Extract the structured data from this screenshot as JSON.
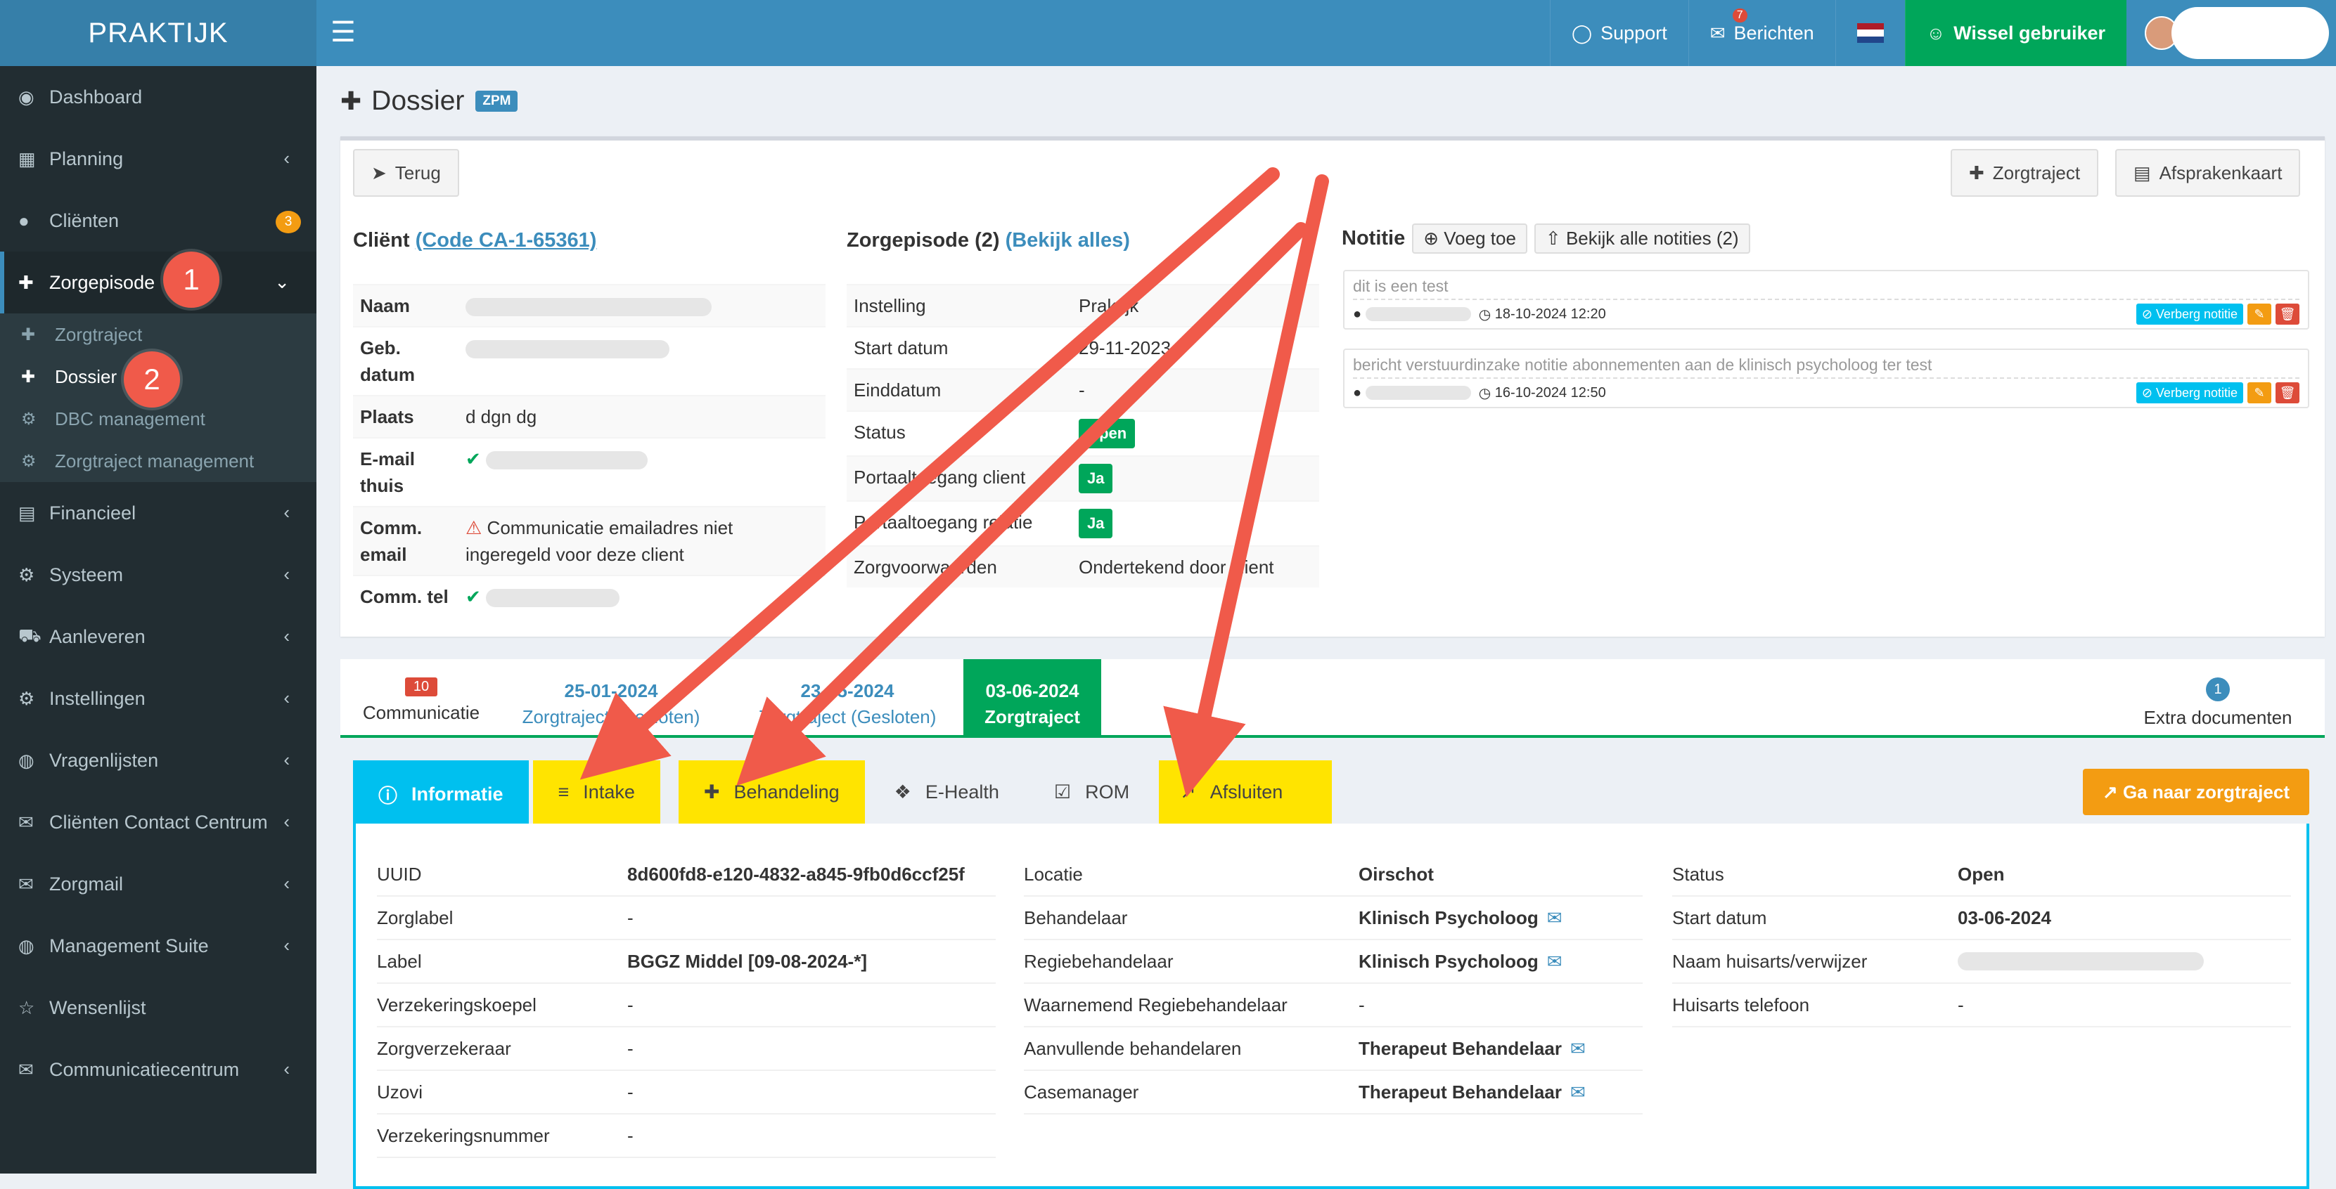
{
  "header": {
    "logo": "PRAKTIJK",
    "support": "Support",
    "berichten": "Berichten",
    "berichten_count": "7",
    "wissel": "Wissel gebruiker"
  },
  "sidebar": {
    "items": [
      {
        "label": "Dashboard",
        "icon": "dashboard-icon"
      },
      {
        "label": "Planning",
        "icon": "calendar-icon"
      },
      {
        "label": "Cliënten",
        "icon": "user-icon",
        "badge": "3"
      },
      {
        "label": "Zorgepisode",
        "icon": "medkit-icon"
      },
      {
        "label": "Financieel",
        "icon": "book-icon"
      },
      {
        "label": "Systeem",
        "icon": "cogs-icon"
      },
      {
        "label": "Aanleveren",
        "icon": "truck-icon"
      },
      {
        "label": "Instellingen",
        "icon": "gear-icon"
      },
      {
        "label": "Vragenlijsten",
        "icon": "globe-icon"
      },
      {
        "label": "Cliënten Contact Centrum",
        "icon": "envelope-icon"
      },
      {
        "label": "Zorgmail",
        "icon": "envelope-icon"
      },
      {
        "label": "Management Suite",
        "icon": "globe-icon"
      },
      {
        "label": "Wensenlijst",
        "icon": "star-icon"
      },
      {
        "label": "Communicatiecentrum",
        "icon": "envelope-icon"
      }
    ],
    "subitems": [
      {
        "label": "Zorgtraject"
      },
      {
        "label": "Dossier"
      },
      {
        "label": "DBC management"
      },
      {
        "label": "Zorgtraject management"
      }
    ],
    "callout1": "1",
    "callout2": "2"
  },
  "page": {
    "title": "Dossier",
    "badge": "ZPM",
    "back": "Terug",
    "zorgtraject_btn": "Zorgtraject",
    "afsprakenkaart_btn": "Afsprakenkaart"
  },
  "client": {
    "title": "Cliënt",
    "code": "(Code CA-1-65361)",
    "rows": [
      {
        "k": "Naam",
        "v": ""
      },
      {
        "k": "Geb. datum",
        "v": ""
      },
      {
        "k": "Plaats",
        "v": "d dgn dg"
      },
      {
        "k": "E-mail thuis",
        "v": ""
      },
      {
        "k": "Comm. email",
        "v": "Communicatie emailadres niet ingeregeld voor deze client"
      },
      {
        "k": "Comm. tel",
        "v": ""
      }
    ]
  },
  "episode": {
    "title": "Zorgepisode (2)",
    "link": "(Bekijk alles)",
    "rows": [
      {
        "k": "Instelling",
        "v": "Praktijk"
      },
      {
        "k": "Start datum",
        "v": "29-11-2023"
      },
      {
        "k": "Einddatum",
        "v": "-"
      },
      {
        "k": "Status",
        "v": "Open"
      },
      {
        "k": "Portaaltoegang client",
        "v": "Ja"
      },
      {
        "k": "Portaaltoegang relatie",
        "v": "Ja"
      },
      {
        "k": "Zorgvoorwaarden",
        "v": "Ondertekend door client"
      }
    ]
  },
  "notes": {
    "title": "Notitie",
    "add": "Voeg toe",
    "all": "Bekijk alle notities (2)",
    "items": [
      {
        "text": "dit is een test",
        "date": "18-10-2024 12:20",
        "hide": "Verberg notitie"
      },
      {
        "text": "bericht verstuurdinzake notitie abonnementen aan de klinisch psycholoog ter test",
        "date": "16-10-2024 12:50",
        "hide": "Verberg notitie"
      }
    ]
  },
  "traject_tabs": {
    "communicatie_count": "10",
    "communicatie": "Communicatie",
    "t1_date": "25-01-2024",
    "t1_label": "Zorgtraject (Gesloten)",
    "t2_date": "23-05-2024",
    "t2_label": "Zorgtraject (Gesloten)",
    "t3_date": "03-06-2024",
    "t3_label": "Zorgtraject",
    "extra_count": "1",
    "extra": "Extra documenten"
  },
  "sub_tabs": [
    {
      "label": "Informatie"
    },
    {
      "label": "Intake"
    },
    {
      "label": "Behandeling"
    },
    {
      "label": "E-Health"
    },
    {
      "label": "ROM"
    },
    {
      "label": "Afsluiten"
    }
  ],
  "goto": "Ga naar zorgtraject",
  "info": {
    "col1": [
      {
        "k": "UUID",
        "v": "8d600fd8-e120-4832-a845-9fb0d6ccf25f"
      },
      {
        "k": "Zorglabel",
        "v": "-"
      },
      {
        "k": "Label",
        "v": "BGGZ Middel [09-08-2024-*]"
      },
      {
        "k": "Verzekeringskoepel",
        "v": "-"
      },
      {
        "k": "Zorgverzekeraar",
        "v": "-"
      },
      {
        "k": "Uzovi",
        "v": "-"
      },
      {
        "k": "Verzekeringsnummer",
        "v": "-"
      }
    ],
    "col2": [
      {
        "k": "Locatie",
        "v": "Oirschot"
      },
      {
        "k": "Behandelaar",
        "v": "Klinisch Psycholoog"
      },
      {
        "k": "Regiebehandelaar",
        "v": "Klinisch Psycholoog"
      },
      {
        "k": "Waarnemend Regiebehandelaar",
        "v": "-"
      },
      {
        "k": "Aanvullende behandelaren",
        "v": "Therapeut Behandelaar"
      },
      {
        "k": "Casemanager",
        "v": "Therapeut Behandelaar"
      }
    ],
    "col3": [
      {
        "k": "Status",
        "v": "Open"
      },
      {
        "k": "Start datum",
        "v": "03-06-2024"
      },
      {
        "k": "Naam huisarts/verwijzer",
        "v": ""
      },
      {
        "k": "Huisarts telefoon",
        "v": "-"
      }
    ]
  },
  "colors": {
    "primary": "#3c8dbc",
    "success": "#00a65a",
    "info": "#00c0ef",
    "warning": "#f39c12",
    "danger": "#dd4b39",
    "highlight": "#ffe400",
    "arrow": "#f05a4a"
  }
}
